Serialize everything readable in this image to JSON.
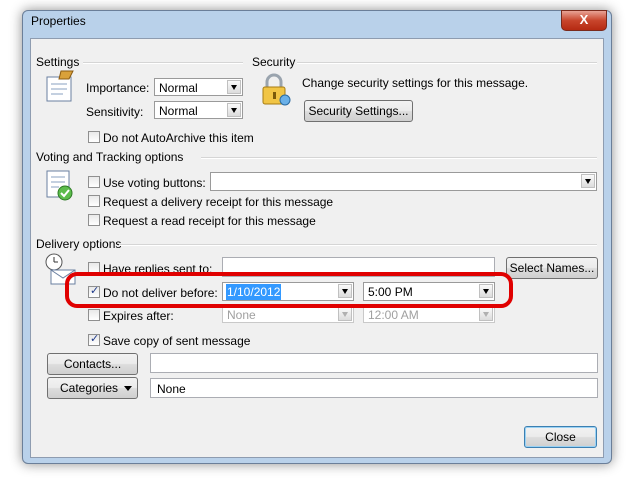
{
  "window": {
    "title": "Properties",
    "close_glyph": "X"
  },
  "settings": {
    "heading": "Settings",
    "importance_label": "Importance:",
    "importance_value": "Normal",
    "sensitivity_label": "Sensitivity:",
    "sensitivity_value": "Normal",
    "autoarchive_label": "Do not AutoArchive this item",
    "autoarchive_checked": false
  },
  "security": {
    "heading": "Security",
    "description": "Change security settings for this message.",
    "button_label": "Security Settings..."
  },
  "voting": {
    "heading": "Voting and Tracking options",
    "use_voting_label": "Use voting buttons:",
    "use_voting_value": "",
    "delivery_receipt_label": "Request a delivery receipt for this message",
    "read_receipt_label": "Request a read receipt for this message"
  },
  "delivery": {
    "heading": "Delivery options",
    "replies_label": "Have replies sent to:",
    "replies_value": "",
    "select_names_label": "Select Names...",
    "dnd_label": "Do not deliver before:",
    "dnd_checked": true,
    "dnd_date": "1/10/2012",
    "dnd_time": "5:00 PM",
    "expires_label": "Expires after:",
    "expires_checked": false,
    "expires_date": "None",
    "expires_time": "12:00 AM",
    "save_copy_label": "Save copy of sent message",
    "save_copy_checked": true
  },
  "contacts": {
    "button_label": "Contacts...",
    "value": ""
  },
  "categories": {
    "button_label": "Categories",
    "value": "None"
  },
  "footer": {
    "close_label": "Close"
  },
  "colors": {
    "highlight": "#e00000",
    "selection": "#3399ff"
  }
}
